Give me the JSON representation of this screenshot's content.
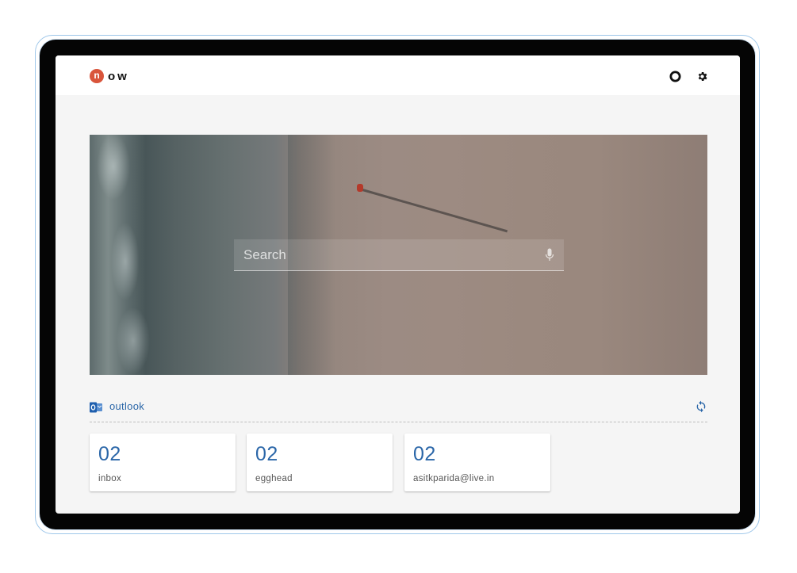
{
  "app": {
    "logo_badge": "n",
    "logo_text": "ow",
    "brand_color": "#d9553b",
    "accent_color": "#2a66a8"
  },
  "topbar": {
    "icons": [
      "circle-icon",
      "gear-icon"
    ]
  },
  "search": {
    "placeholder": "Search",
    "value": "",
    "icon": "mic-icon"
  },
  "section": {
    "title": "outlook",
    "icon": "outlook-icon",
    "action_icon": "sync-icon"
  },
  "cards": [
    {
      "count": "02",
      "label": "inbox"
    },
    {
      "count": "02",
      "label": "egghead"
    },
    {
      "count": "02",
      "label": "asitkparida@live.in"
    }
  ]
}
